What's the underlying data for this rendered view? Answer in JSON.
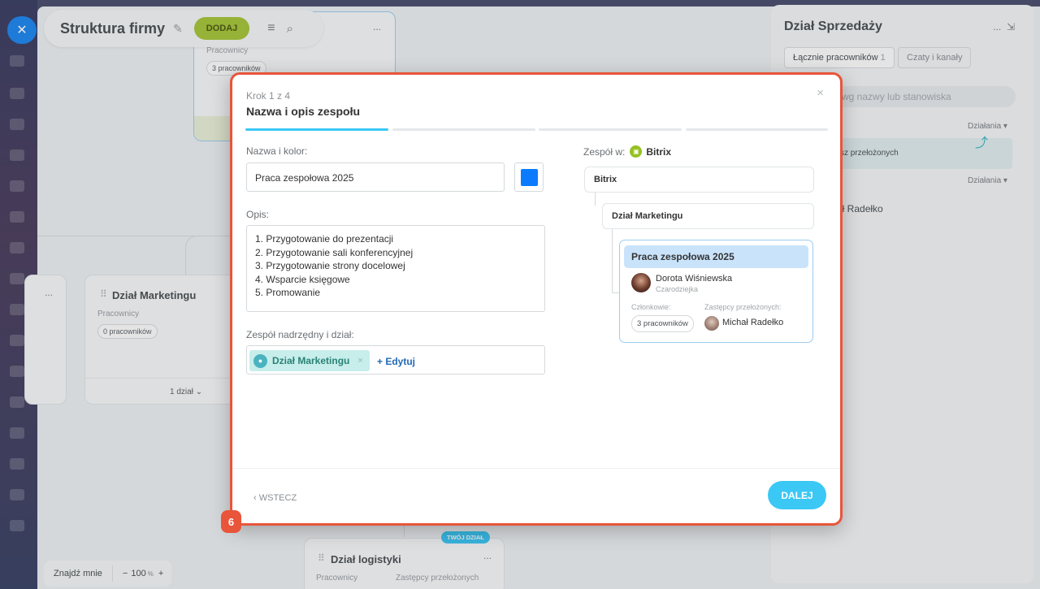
{
  "window": {
    "close_icon": "close-icon"
  },
  "header": {
    "title": "Struktura firmy",
    "add_label": "DODAJ",
    "menu_icon": "menu-icon",
    "search_icon": "search-icon",
    "more": "..."
  },
  "background_cards": {
    "top_card": {
      "employees_label": "Pracownicy",
      "count": "3 pracowników"
    },
    "left_card": {
      "more": "..."
    },
    "marketing_card": {
      "name": "Dział Marketingu",
      "employees_label": "Pracownicy",
      "count": "0 pracowników",
      "footer": "1 dział"
    },
    "logistics_card": {
      "badge": "TWÓJ DZIAŁ",
      "name": "Dział logistyki",
      "employees_label": "Pracownicy",
      "deputies_label": "Zastępcy przełożonych",
      "more": "..."
    }
  },
  "right_panel": {
    "title": "Dział Sprzedaży",
    "more": "...",
    "tab_employees": "Łącznie pracowników",
    "tab_employees_count": "1",
    "tab_chats": "Czaty i kanały",
    "search_placeholder": "wg nazwy lub stanowiska",
    "actions_1": "Działania",
    "row_text": "sz przełożonych",
    "actions_2": "Działania",
    "person": "ał Radełko"
  },
  "zoom": {
    "find_me": "Znajdź mnie",
    "minus": "−",
    "value": "100",
    "unit": "%",
    "plus": "+"
  },
  "modal": {
    "step": "Krok 1 z 4",
    "title": "Nazwa i opis zespołu",
    "progress_total": 4,
    "progress_current": 1,
    "name_color_label": "Nazwa i kolor:",
    "name_value": "Praca zespołowa 2025",
    "color": "#0a7bff",
    "description_label": "Opis:",
    "description_lines": [
      "1. Przygotowanie do prezentacji",
      "2. Przygotowanie sali konferencyjnej",
      "3. Przygotowanie strony docelowej",
      "4. Wsparcie księgowe",
      "5. Promowanie"
    ],
    "parent_label": "Zespół nadrzędny i dział:",
    "parent_chip": "Dział Marketingu",
    "edit_link": "+ Edytuj",
    "tree_label": "Zespół w:",
    "tree_company": "Bitrix",
    "tree_root": "Bitrix",
    "tree_department": "Dział Marketingu",
    "team_name": "Praca zespołowa 2025",
    "lead_name": "Dorota Wiśniewska",
    "lead_position": "Czarodziejka",
    "members_label": "Członkowie:",
    "members_count": "3 pracowników",
    "deputies_label": "Zastępcy przełożonych:",
    "deputy_name": "Michał Radełko",
    "back_label": "WSTECZ",
    "next_label": "DALEJ"
  },
  "step_badge": "6",
  "colors": {
    "accent": "#3bc8f5",
    "highlight_border": "#e8553a",
    "add_button": "#a7c63a"
  }
}
